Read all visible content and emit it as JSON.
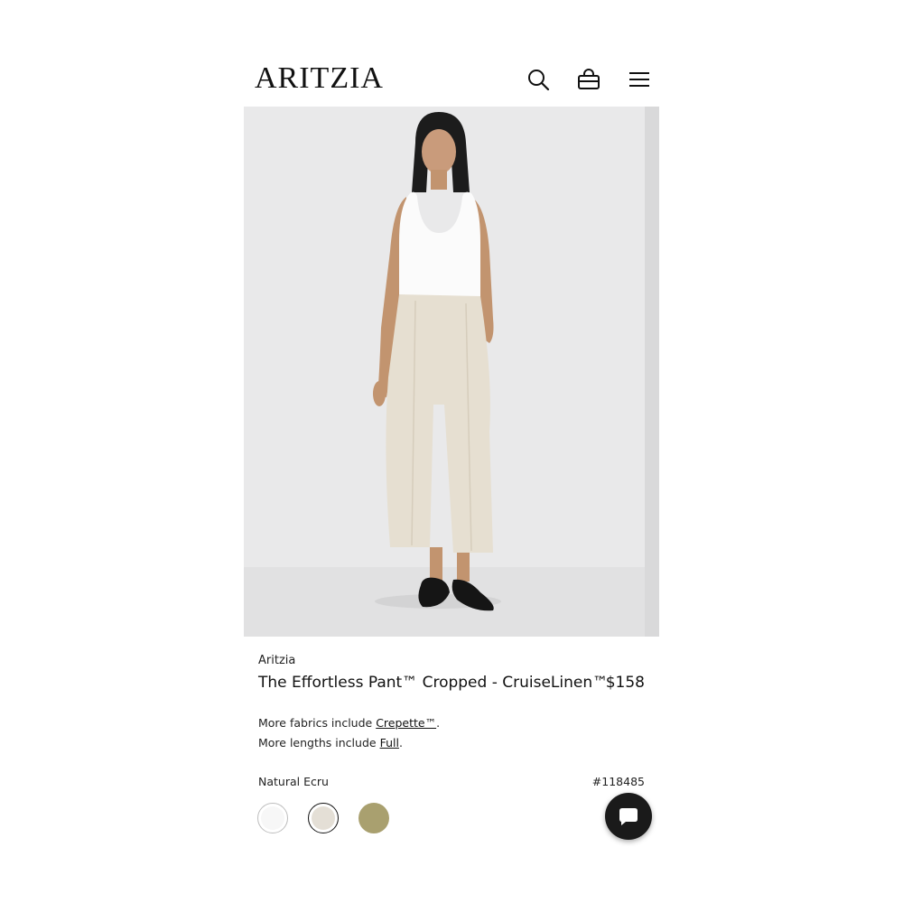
{
  "header": {
    "logo": "ARITZIA",
    "icons": [
      "search-icon",
      "bag-icon",
      "menu-icon"
    ]
  },
  "product": {
    "brand": "Aritzia",
    "title": "The Effortless Pant™ Cropped - CruiseLinen™",
    "price": "$158",
    "fabrics_prefix": "More fabrics include ",
    "fabrics_link": "Crepette™",
    "fabrics_suffix": ".",
    "lengths_prefix": "More lengths include ",
    "lengths_link": "Full",
    "lengths_suffix": ".",
    "color_name": "Natural Ecru",
    "sku": "#118485",
    "swatches": [
      {
        "color": "#f7f7f7",
        "selected": false
      },
      {
        "color": "#e4dfd6",
        "selected": true
      },
      {
        "color": "#a9a06f",
        "selected": false
      }
    ]
  },
  "colors": {
    "background": "#ffffff",
    "photo_bg": "#e9e9ea",
    "text": "#111111",
    "chat_button": "#1a1a1a"
  }
}
